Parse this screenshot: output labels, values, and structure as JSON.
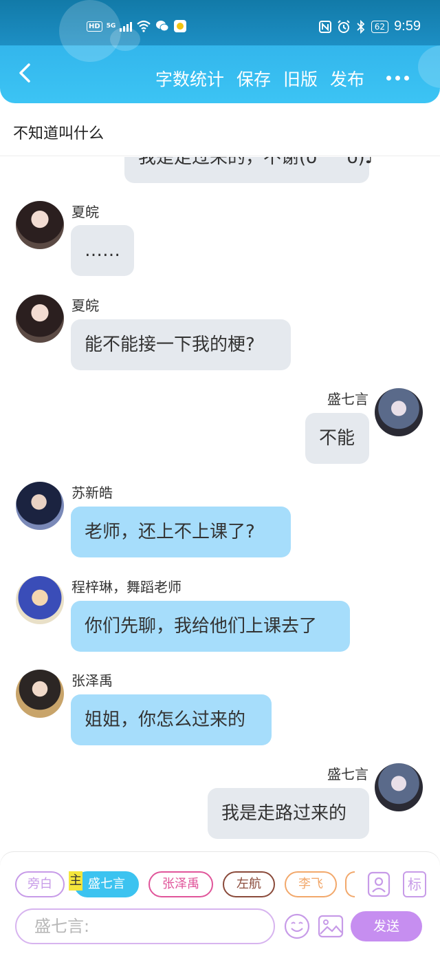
{
  "status_bar": {
    "left_badges": [
      "HD",
      "5G"
    ],
    "battery": "62",
    "time": "9:59"
  },
  "header": {
    "actions": [
      "字数统计",
      "保存",
      "旧版",
      "发布"
    ]
  },
  "chat_title": "不知道叫什么",
  "messages": [
    {
      "side": "right",
      "name": "",
      "text": "我是走过来的，不谢(ò^^ó)♪",
      "style": "grey"
    },
    {
      "side": "left",
      "name": "夏皖",
      "text": "……",
      "style": "grey"
    },
    {
      "side": "left",
      "name": "夏皖",
      "text": "能不能接一下我的梗?",
      "style": "grey"
    },
    {
      "side": "right",
      "name": "盛七言",
      "text": "不能",
      "style": "grey"
    },
    {
      "side": "left",
      "name": "苏新皓",
      "text": "老师，还上不上课了?",
      "style": "blue"
    },
    {
      "side": "left",
      "name": "程梓琳，舞蹈老师",
      "text": "你们先聊，我给他们上课去了",
      "style": "blue"
    },
    {
      "side": "left",
      "name": "张泽禹",
      "text": "姐姐，你怎么过来的",
      "style": "blue"
    },
    {
      "side": "right",
      "name": "盛七言",
      "text": "我是走路过来的",
      "style": "grey"
    }
  ],
  "composer": {
    "characters": [
      {
        "label": "旁白",
        "color": "#c79be8"
      },
      {
        "label": "盛七言",
        "color": "#3cc3f0"
      },
      {
        "label": "张泽禹",
        "color": "#e0559a"
      },
      {
        "label": "左航",
        "color": "#8a4a3a"
      },
      {
        "label": "李飞",
        "color": "#f2a86b"
      }
    ],
    "main_tag": "主",
    "mark_label": "标",
    "input_placeholder": "盛七言:",
    "send_label": "发送"
  },
  "colors": {
    "header_top": "#127aa8",
    "header_bottom": "#3cc4f4",
    "bubble_grey": "#e5e9ee",
    "bubble_blue": "#a6ddfb",
    "send_button": "#c68ef0"
  }
}
